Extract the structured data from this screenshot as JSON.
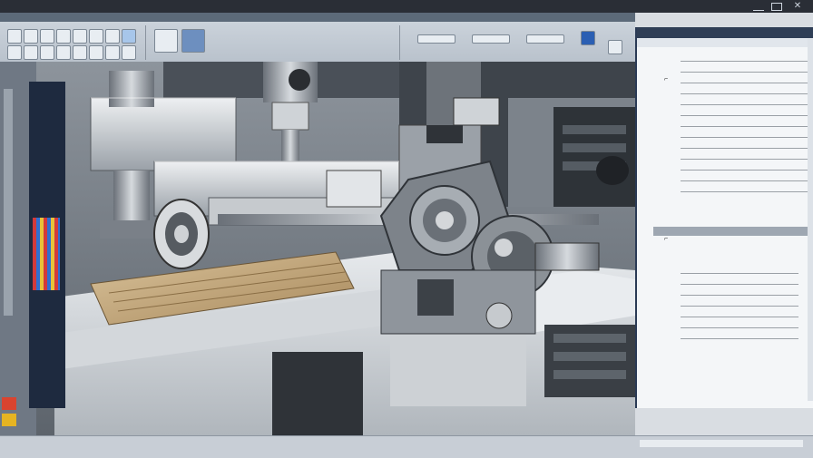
{
  "titlebar": {
    "app_title": "",
    "doc_title": ""
  },
  "ribbon": {
    "tabs": [
      "",
      "",
      "",
      "",
      "",
      ""
    ],
    "groups": [
      "",
      "",
      "",
      ""
    ]
  },
  "properties": {
    "header": "",
    "rows_a": [
      "",
      "",
      "",
      "",
      "",
      "",
      "",
      "",
      "",
      "",
      "",
      "",
      ""
    ],
    "rows_b": [
      "",
      "",
      "",
      "",
      "",
      "",
      ""
    ]
  },
  "statusbar": {
    "left": "",
    "right": ""
  },
  "icons": [
    "minimize-icon",
    "maximize-icon",
    "close-icon",
    "expand-icon",
    "collapse-icon"
  ],
  "colors": {
    "title_bar": "#2a2e36",
    "panel_header": "#2f3e56",
    "accent": "#2b5fb3",
    "machine_gray": "#b9bfc6",
    "wood": "#c8ae84"
  }
}
